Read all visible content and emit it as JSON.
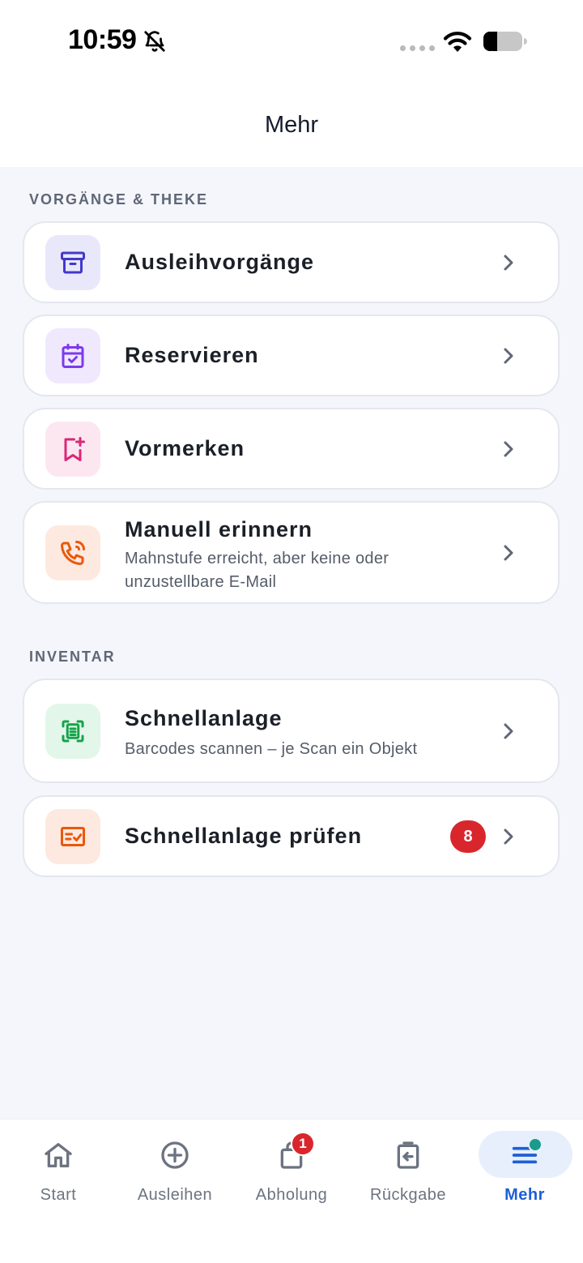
{
  "status_bar": {
    "time": "10:59"
  },
  "header": {
    "title": "Mehr"
  },
  "sections": [
    {
      "label": "VORGÄNGE & THEKE"
    },
    {
      "label": "INVENTAR"
    }
  ],
  "items": [
    {
      "title": "Ausleihvorgänge",
      "icon": "archive-icon",
      "color": "#4338ca",
      "bg": "#e9e8fb"
    },
    {
      "title": "Reservieren",
      "icon": "calendar-check-icon",
      "color": "#7c3aed",
      "bg": "#f0e8fd"
    },
    {
      "title": "Vormerken",
      "icon": "bookmark-plus-icon",
      "color": "#db2777",
      "bg": "#fce7f1"
    },
    {
      "title": "Manuell erinnern",
      "subtitle": "Mahnstufe erreicht, aber keine oder unzustellbare E-Mail",
      "icon": "phone-call-icon",
      "color": "#ea580c",
      "bg": "#fde9df"
    },
    {
      "title": "Schnellanlage",
      "subtitle": "Barcodes scannen – je Scan ein Objekt",
      "icon": "scan-icon",
      "color": "#16a34a",
      "bg": "#e3f6ea"
    },
    {
      "title": "Schnellanlage prüfen",
      "badge": "8",
      "icon": "checklist-icon",
      "color": "#ea580c",
      "bg": "#fde9df"
    }
  ],
  "tabs": [
    {
      "label": "Start",
      "icon": "home-icon"
    },
    {
      "label": "Ausleihen",
      "icon": "plus-circle-icon"
    },
    {
      "label": "Abholung",
      "icon": "shopping-bag-icon",
      "badge": "1"
    },
    {
      "label": "Rückgabe",
      "icon": "return-icon"
    },
    {
      "label": "Mehr",
      "icon": "menu-icon",
      "active": true
    }
  ],
  "colors": {
    "accent": "#1e5fd6",
    "badge": "#d9262c",
    "background": "#f4f6fb"
  }
}
